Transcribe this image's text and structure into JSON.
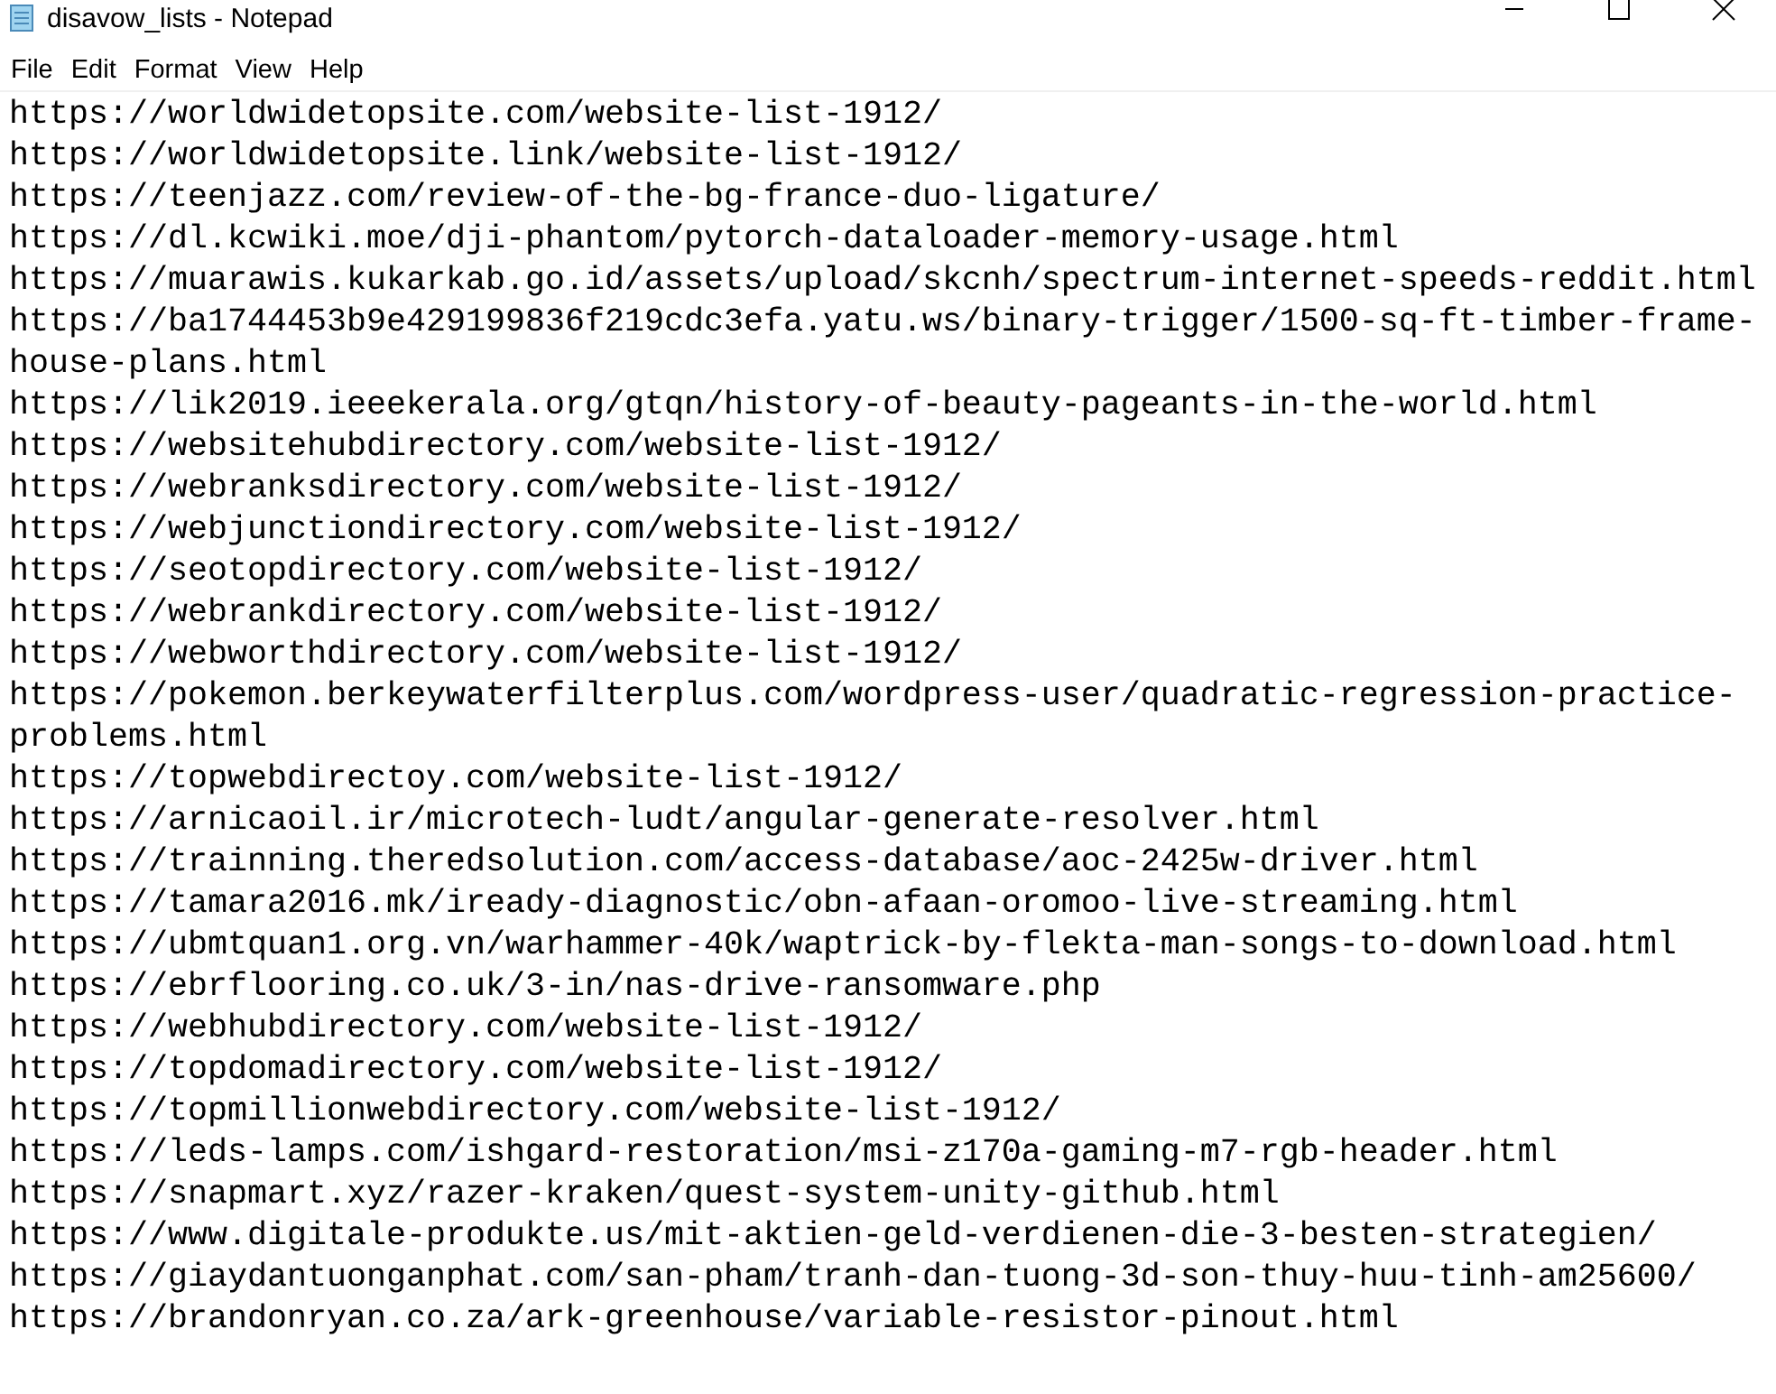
{
  "window": {
    "title": "disavow_lists - Notepad"
  },
  "menu": [
    {
      "label": "File"
    },
    {
      "label": "Edit"
    },
    {
      "label": "Format"
    },
    {
      "label": "View"
    },
    {
      "label": "Help"
    }
  ],
  "editor": {
    "lines": [
      "https://worldwidetopsite.com/website-list-1912/",
      "https://worldwidetopsite.link/website-list-1912/",
      "https://teenjazz.com/review-of-the-bg-france-duo-ligature/",
      "https://dl.kcwiki.moe/dji-phantom/pytorch-dataloader-memory-usage.html",
      "https://muarawis.kukarkab.go.id/assets/upload/skcnh/spectrum-internet-speeds-reddit.html",
      "https://ba1744453b9e429199836f219cdc3efa.yatu.ws/binary-trigger/1500-sq-ft-timber-frame-house-plans.html",
      "https://lik2019.ieeekerala.org/gtqn/history-of-beauty-pageants-in-the-world.html",
      "https://websitehubdirectory.com/website-list-1912/",
      "https://webranksdirectory.com/website-list-1912/",
      "https://webjunctiondirectory.com/website-list-1912/",
      "https://seotopdirectory.com/website-list-1912/",
      "https://webrankdirectory.com/website-list-1912/",
      "https://webworthdirectory.com/website-list-1912/",
      "https://pokemon.berkeywaterfilterplus.com/wordpress-user/quadratic-regression-practice-problems.html",
      "https://topwebdirectoy.com/website-list-1912/",
      "https://arnicaoil.ir/microtech-ludt/angular-generate-resolver.html",
      "https://trainning.theredsolution.com/access-database/aoc-2425w-driver.html",
      "https://tamara2016.mk/iready-diagnostic/obn-afaan-oromoo-live-streaming.html",
      "https://ubmtquan1.org.vn/warhammer-40k/waptrick-by-flekta-man-songs-to-download.html",
      "https://ebrflooring.co.uk/3-in/nas-drive-ransomware.php",
      "https://webhubdirectory.com/website-list-1912/",
      "https://topdomadirectory.com/website-list-1912/",
      "https://topmillionwebdirectory.com/website-list-1912/",
      "https://leds-lamps.com/ishgard-restoration/msi-z170a-gaming-m7-rgb-header.html",
      "https://snapmart.xyz/razer-kraken/quest-system-unity-github.html",
      "https://www.digitale-produkte.us/mit-aktien-geld-verdienen-die-3-besten-strategien/",
      "https://giaydantuonganphat.com/san-pham/tranh-dan-tuong-3d-son-thuy-huu-tinh-am25600/",
      "https://brandonryan.co.za/ark-greenhouse/variable-resistor-pinout.html"
    ]
  }
}
